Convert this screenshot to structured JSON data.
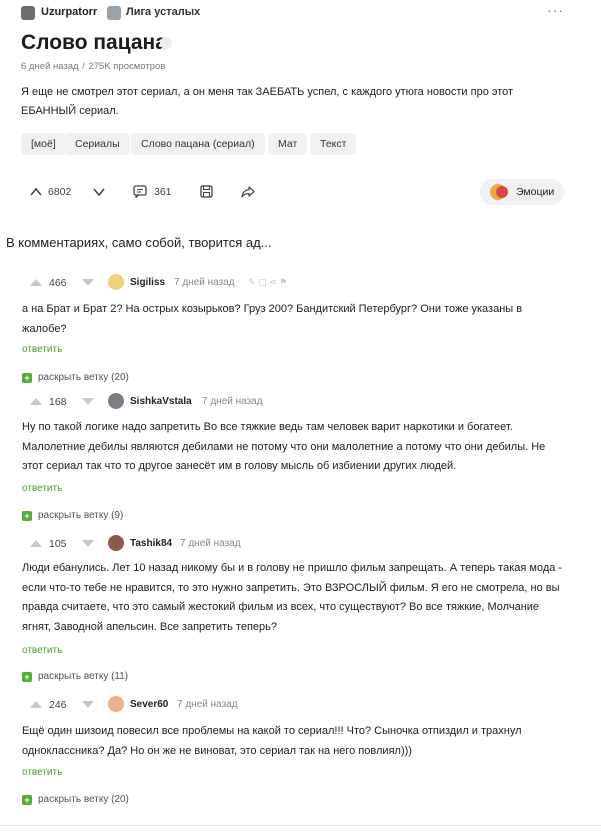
{
  "post": {
    "author": "Uzurpatorr",
    "community": "Лига усталых",
    "more_label": "···",
    "title": "Слово пацана",
    "time": "6 дней назад",
    "meta_sep": "/",
    "views": "275K просмотров",
    "text": "Я еще не смотрел этот сериал, а он меня так ЗАЕБАТЬ успел, с каждого утюга новости про этот ЕБАННЫЙ сериал.",
    "tags": [
      "[моё]",
      "Сериалы",
      "Слово пацана (сериал)",
      "Мат",
      "Текст"
    ],
    "rating": "6802",
    "comments_count": "361",
    "emotions_label": "Эмоции",
    "colors": {
      "accent_green": "#56ad3a",
      "link_green": "#4a9c2a",
      "tag_bg": "#f1f1f3"
    }
  },
  "caption": "В комментариях, само собой, творится ад...",
  "comments": [
    {
      "rating": "466",
      "user": "Sigiliss",
      "time": "7 дней назад",
      "text": "а на Брат и Брат 2? На острых козырьков? Груз 200? Бандитский Петербург? Они тоже указаны в жалобе?",
      "reply": "ответить",
      "expand": "раскрыть ветку (20)",
      "avatar_color": "#f1d27a"
    },
    {
      "rating": "168",
      "user": "SishkaVstala",
      "time": "7 дней назад",
      "text": "Ну по такой логике надо запретить Во все тяжкие ведь там человек варит наркотики и богатеет. Малолетние дебилы являются дебилами не потому что они малолетние а потому что они дебилы. Не этот сериал так что то другое занесёт им в голову мысль об избиении других людей.",
      "reply": "ответить",
      "expand": "раскрыть ветку (9)",
      "avatar_color": "#7d7d85"
    },
    {
      "rating": "105",
      "user": "Tashik84",
      "time": "7 дней назад",
      "text": "Люди ебанулись. Лет 10 назад никому бы и в голову не пришло фильм запрещать. А теперь такая мода - если что-то тебе не нравится, то это нужно запретить. Это ВЗРОСЛЫЙ фильм. Я его не смотрела, но вы правда считаете, что это самый жестокий фильм из всех, что существуют? Во все тяжкие, Молчание ягнят, Заводной апельсин. Все запретить теперь?",
      "reply": "ответить",
      "expand": "раскрыть ветку (11)",
      "avatar_color": "#8a5a4a"
    },
    {
      "rating": "246",
      "user": "Sever60",
      "time": "7 дней назад",
      "text": "Ещё один шизоид повесил все проблемы на какой то сериал!!! Что? Сыночка отпиздил и трахнул одноклассника? Да? Но он же не виноват, это сериал так на него повлиял)))",
      "reply": "ответить",
      "expand": "раскрыть ветку (20)",
      "avatar_color": "#e7b38c"
    }
  ]
}
